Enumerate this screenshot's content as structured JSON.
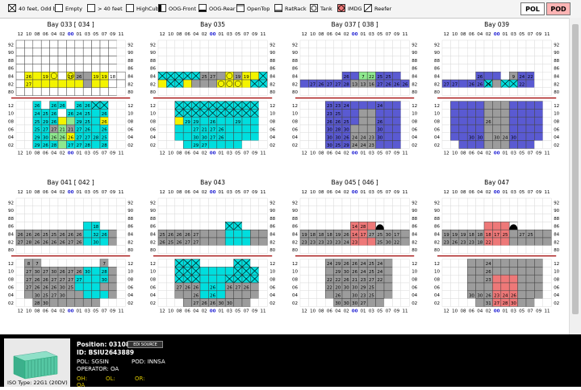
{
  "legend": [
    {
      "id": "fe40",
      "label": "40 feet, Odd bay",
      "swatch": "cross"
    },
    {
      "id": "empty",
      "label": "Empty",
      "swatch": "empty"
    },
    {
      "id": "gt40",
      "label": "> 40 feet",
      "swatch": "gt40"
    },
    {
      "id": "hc",
      "label": "HighCube",
      "swatch": "hc"
    },
    {
      "id": "oogf",
      "label": "OOG-Front",
      "swatch": "oogf"
    },
    {
      "id": "oogr",
      "label": "OOG-Rear",
      "swatch": "oogr"
    },
    {
      "id": "ot",
      "label": "OpenTop",
      "swatch": "ot"
    },
    {
      "id": "rr",
      "label": "RatRack",
      "swatch": "rr"
    },
    {
      "id": "tank",
      "label": "Tank",
      "swatch": "tank"
    },
    {
      "id": "imdg",
      "label": "IMDG",
      "swatch": "imdg"
    },
    {
      "id": "reefer",
      "label": "Reefer",
      "swatch": "reefer"
    }
  ],
  "buttons": {
    "pol": "POL",
    "pod": "POD"
  },
  "colors": {
    "cyan": "#00dede",
    "yellow": "#f4f400",
    "gray": "#9c9c9c",
    "blue": "#5a5ad2",
    "green": "#8ee88e",
    "red": "#ee7878",
    "white": "#ffffff",
    "bg": "#ffffff",
    "hatch": "#a00000"
  },
  "row_labels": [
    "12",
    "10",
    "08",
    "06",
    "04",
    "02",
    "00",
    "01",
    "03",
    "05",
    "07",
    "09",
    "11"
  ],
  "deck_tier_labels": [
    "92",
    "90",
    "88",
    "86",
    "84",
    "82",
    "80"
  ],
  "hold_tier_labels": [
    "12",
    "10",
    "08",
    "06",
    "04",
    "02"
  ],
  "bays": [
    {
      "title": "Bay 033 [ 034 ]",
      "deck": [
        "cccccccccccc.",
        "cccccccccccc.",
        "cccccccccccc.",
        "cccccccccccc.",
        "cYYYSgSGGYYcc",
        "cYYYYYYYGYYcc",
        "cccccccccccc."
      ],
      "deck_labels": [
        [],
        [],
        [],
        [],
        [
          "",
          "26",
          "",
          "19",
          "",
          "",
          "26",
          "26",
          "",
          "19",
          "19",
          "18",
          ""
        ],
        [
          "",
          "27",
          "",
          "",
          "",
          "",
          "",
          "",
          "",
          "",
          "",
          "",
          ""
        ],
        []
      ],
      "hold": [
        "..C.CC.CCXX..",
        "..CCC.CCCCC..",
        "..CCCYWCCCY..",
        "..CCGWGCCCC..",
        "..CCWWYCCCC..",
        "..CCCWCCCCC.."
      ],
      "hold_labels": [
        [
          "",
          "",
          "26",
          "",
          "26",
          "26",
          "",
          "26",
          "26",
          "",
          "",
          "",
          ""
        ],
        [
          "",
          "",
          "24",
          "25",
          "26",
          "",
          "26",
          "24",
          "25",
          "",
          "26",
          "",
          ""
        ],
        [
          "",
          "",
          "25",
          "29",
          "26",
          "",
          "",
          "29",
          "25",
          "",
          "26",
          "",
          ""
        ],
        [
          "",
          "",
          "25",
          "27",
          "27",
          "21",
          "21",
          "27",
          "26",
          "",
          "26",
          "",
          ""
        ],
        [
          "",
          "",
          "29",
          "30",
          "26",
          "26",
          "26",
          "27",
          "27",
          "28",
          "25",
          "",
          ""
        ],
        [
          "",
          "",
          "29",
          "26",
          "28",
          "",
          "27",
          "27",
          "28",
          "",
          "28",
          "",
          ""
        ]
      ]
    },
    {
      "title": "Bay 035",
      "deck": [
        ".............",
        ".............",
        ".............",
        ".............",
        "XXXXXGGGSGYYX",
        "YXXYGGGSSSYXX",
        "............."
      ],
      "deck_labels": [
        [],
        [],
        [],
        [],
        [
          "",
          "",
          "",
          "",
          "",
          "25",
          "27",
          "",
          "",
          "19",
          "19",
          "",
          ""
        ],
        [
          "",
          "",
          "",
          "",
          "",
          "",
          "",
          "",
          "",
          "",
          "",
          "",
          ""
        ],
        []
      ],
      "hold": [
        "..XXXXXXXXXX.",
        "..XXXXXXXXXX.",
        "..YCCCCCCCCC.",
        "..CCCCCCCCCC.",
        "..CCCCCCCCCC.",
        "...CCCCCCC..."
      ],
      "hold_labels": [
        [],
        [],
        [
          "",
          "",
          "",
          "29",
          "29",
          "",
          "26",
          "",
          "",
          "29",
          "",
          "",
          ""
        ],
        [
          "",
          "",
          "",
          "",
          "27",
          "21",
          "27",
          "26",
          "",
          "",
          "",
          "",
          ""
        ],
        [
          "",
          "",
          "",
          "",
          "30",
          "30",
          "27",
          "26",
          "",
          "",
          "",
          "",
          ""
        ],
        [
          "",
          "",
          "",
          "",
          "29",
          "27",
          "",
          "",
          "",
          "",
          "",
          "",
          ""
        ]
      ]
    },
    {
      "title": "Bay 037 [ 038 ]",
      "deck": [
        ".............",
        ".............",
        ".............",
        ".............",
        ".....BBWWBBB.",
        "BBBBBBGGGBBBB",
        "............."
      ],
      "deck_labels": [
        [],
        [],
        [],
        [],
        [
          "",
          "",
          "",
          "",
          "",
          "26",
          "",
          "7",
          "22",
          "25",
          "25",
          "",
          ""
        ],
        [
          "",
          "27",
          "26",
          "27",
          "27",
          "28",
          "13",
          "13",
          "16",
          "27",
          "26",
          "26",
          "26"
        ],
        []
      ],
      "hold": [
        "...BBBBBBBBB.",
        "...BBBBGGBBB.",
        "...BBBBGGBBB.",
        "...BBBGGGBBB.",
        "...BBBGGGBBB.",
        "...BBBGGGBBB."
      ],
      "hold_labels": [
        [
          "",
          "",
          "",
          "23",
          "23",
          "24",
          "",
          "",
          "",
          "24",
          "",
          "",
          ""
        ],
        [
          "",
          "",
          "",
          "23",
          "25",
          "",
          "",
          "",
          "",
          "",
          "",
          "",
          ""
        ],
        [
          "",
          "",
          "",
          "26",
          "26",
          "25",
          "",
          "",
          "",
          "26",
          "",
          "",
          ""
        ],
        [
          "",
          "",
          "",
          "30",
          "28",
          "30",
          "",
          "",
          "",
          "30",
          "",
          "",
          ""
        ],
        [
          "",
          "",
          "",
          "30",
          "30",
          "26",
          "24",
          "24",
          "23",
          "30",
          "",
          "",
          ""
        ],
        [
          "",
          "",
          "",
          "30",
          "25",
          "29",
          "24",
          "24",
          "23",
          "",
          "",
          "",
          ""
        ]
      ]
    },
    {
      "title": "Bay 039",
      "deck": [
        ".............",
        ".............",
        ".............",
        ".............",
        "....BBB.GBB..",
        "BBBBBXGXXBB..",
        "............."
      ],
      "deck_labels": [
        [],
        [],
        [],
        [],
        [
          "",
          "",
          "",
          "",
          "26",
          "",
          "",
          "",
          "9",
          "24",
          "22",
          "",
          ""
        ],
        [
          "27",
          "27",
          "",
          "26",
          "26",
          "26",
          "",
          "",
          "",
          "22",
          "",
          "",
          ""
        ],
        []
      ],
      "hold": [
        ".BBBBGGGBBBB.",
        ".BBBBGGGBBBB.",
        ".BBBBGGGBBBB.",
        ".BBBBGGGBBBB.",
        ".BBBBGGGBBBB.",
        "..BBBGGGBBB.."
      ],
      "hold_labels": [
        [],
        [],
        [
          "",
          "",
          "",
          "",
          "",
          "26",
          "",
          "",
          "",
          "",
          "",
          "",
          ""
        ],
        [
          "",
          "",
          "",
          "",
          "",
          "",
          "",
          "",
          "",
          "",
          "",
          "",
          ""
        ],
        [
          "",
          "",
          "",
          "30",
          "30",
          "",
          "30",
          "24",
          "30",
          "",
          "",
          "",
          ""
        ],
        [
          "",
          "",
          "",
          "",
          "",
          "",
          "",
          "",
          "",
          "",
          "",
          "",
          ""
        ]
      ]
    },
    {
      "title": "Bay 041 [ 042 ]",
      "deck": [
        ".............",
        ".............",
        ".............",
        "........CC...",
        "GGGGGGGGCCCG.",
        "GGGGGGGGCCCG.",
        "............."
      ],
      "deck_labels": [
        [],
        [],
        [],
        [
          "",
          "",
          "",
          "",
          "",
          "",
          "",
          "",
          "",
          "18",
          "",
          "",
          ""
        ],
        [
          "26",
          "26",
          "26",
          "25",
          "25",
          "26",
          "26",
          "26",
          "",
          "32",
          "26",
          "",
          ""
        ],
        [
          "27",
          "28",
          "26",
          "26",
          "26",
          "26",
          "27",
          "26",
          "",
          "30",
          "",
          "",
          ""
        ],
        []
      ],
      "hold": [
        ".GG.......G..",
        ".GGGGGGGCCCG.",
        ".GGGGGGCCCCG.",
        ".GGGGGGCCCGG.",
        ".GGGGGGGCCCG.",
        "..GGGGGGGG..."
      ],
      "hold_labels": [
        [
          "",
          "8",
          "7",
          "",
          "",
          "",
          "",
          "",
          "",
          "",
          "7",
          "",
          ""
        ],
        [
          "",
          "27",
          "30",
          "27",
          "30",
          "26",
          "27",
          "26",
          "30",
          "",
          "28",
          "",
          ""
        ],
        [
          "",
          "27",
          "26",
          "26",
          "27",
          "27",
          "27",
          "27",
          "",
          "",
          "30",
          "",
          ""
        ],
        [
          "",
          "27",
          "26",
          "26",
          "26",
          "30",
          "25",
          "",
          "",
          "",
          "",
          "",
          ""
        ],
        [
          "",
          "",
          "30",
          "25",
          "27",
          "30",
          "",
          "",
          "",
          "",
          "",
          "",
          ""
        ],
        [
          "",
          "",
          "28",
          "30",
          "",
          "",
          "",
          "",
          "",
          "",
          "",
          "",
          ""
        ]
      ]
    },
    {
      "title": "Bay 043",
      "deck": [
        ".............",
        ".............",
        ".............",
        "........XX...",
        "GGGGGGGGCCCGG",
        "GGGGGGGGCCCGG",
        "............."
      ],
      "deck_labels": [
        [],
        [],
        [],
        [],
        [
          "25",
          "26",
          "26",
          "26",
          "27",
          "",
          "",
          "",
          "",
          "",
          "",
          "",
          ""
        ],
        [
          "26",
          "25",
          "26",
          "27",
          "27",
          "",
          "",
          "",
          "",
          "",
          "",
          "",
          ""
        ],
        []
      ],
      "hold": [
        "..XXX....XX..",
        "..XXXCCCCXXX.",
        "..XXXCCCXXXX.",
        "..GGGCCCGGGG.",
        "..GGGCCCGGGG.",
        "...GGGGGGGG.."
      ],
      "hold_labels": [
        [],
        [],
        [],
        [
          "",
          "",
          "27",
          "26",
          "26",
          "",
          "26",
          "",
          "26",
          "27",
          "26",
          "",
          ""
        ],
        [
          "",
          "",
          "",
          "",
          "26",
          "",
          "26",
          "",
          "",
          "",
          "",
          "",
          ""
        ],
        [
          "",
          "",
          "",
          "",
          "27",
          "26",
          "26",
          "30",
          "30",
          "",
          "",
          "",
          ""
        ]
      ]
    },
    {
      "title": "Bay 045 [ 046 ]",
      "deck": [
        ".............",
        ".............",
        ".............",
        "......RRRD...",
        "GGGGGGRRGGGGG",
        "GGGGGGRRRGGGG",
        "............."
      ],
      "deck_labels": [
        [],
        [],
        [],
        [
          "",
          "",
          "",
          "",
          "",
          "",
          "14",
          "28",
          "",
          "",
          "",
          "",
          ""
        ],
        [
          "19",
          "18",
          "18",
          "18",
          "19",
          "26",
          "14",
          "17",
          "27",
          "25",
          "30",
          "17",
          ""
        ],
        [
          "23",
          "23",
          "23",
          "23",
          "23",
          "24",
          "23",
          "",
          "",
          "25",
          "30",
          "22",
          ""
        ],
        []
      ],
      "hold": [
        "...GGGGGGGG..",
        "...GGGGGGGG..",
        "...GGGGGGGG..",
        "...GGGGGGGG..",
        "...GGGGGGGG..",
        "....GGGGGG..."
      ],
      "hold_labels": [
        [
          "",
          "",
          "",
          "24",
          "29",
          "26",
          "26",
          "24",
          "25",
          "24",
          "",
          "",
          ""
        ],
        [
          "",
          "",
          "",
          "",
          "29",
          "30",
          "26",
          "24",
          "25",
          "24",
          "",
          "",
          ""
        ],
        [
          "",
          "",
          "",
          "22",
          "22",
          "26",
          "21",
          "23",
          "27",
          "22",
          "",
          "",
          ""
        ],
        [
          "",
          "",
          "",
          "22",
          "20",
          "30",
          "30",
          "29",
          "25",
          "",
          "",
          "",
          ""
        ],
        [
          "",
          "",
          "",
          "",
          "26",
          "",
          "30",
          "23",
          "25",
          "",
          "",
          "",
          ""
        ],
        [
          "",
          "",
          "",
          "",
          "30",
          "30",
          "30",
          "27",
          "",
          "",
          "",
          "",
          ""
        ]
      ]
    },
    {
      "title": "Bay 047",
      "deck": [
        ".............",
        ".............",
        ".............",
        ".....RRRD....",
        "GGGGGRRRGGGGG",
        "GGGGGRRRGGGGG",
        "............."
      ],
      "deck_labels": [
        [],
        [],
        [],
        [],
        [
          "19",
          "19",
          "19",
          "18",
          "18",
          "18",
          "17",
          "25",
          "",
          "27",
          "25",
          "",
          ""
        ],
        [
          "23",
          "26",
          "23",
          "23",
          "18",
          "22",
          "",
          "",
          "",
          "",
          "",
          "",
          ""
        ],
        []
      ],
      "hold": [
        "...GGGGGGGGG.",
        "...GGGGGGGGG.",
        "...GGGRRRGGG.",
        "...GGGRRRGGG.",
        "...GGGRRRGGG.",
        "....GGRRRGG.."
      ],
      "hold_labels": [
        [
          "",
          "",
          "",
          "",
          "",
          "24",
          "",
          "",
          "",
          "",
          "",
          "",
          ""
        ],
        [
          "",
          "",
          "",
          "",
          "",
          "26",
          "",
          "",
          "",
          "",
          "",
          "",
          ""
        ],
        [
          "",
          "",
          "",
          "",
          "",
          "23",
          "",
          "",
          "",
          "",
          "",
          "",
          ""
        ],
        [
          "",
          "",
          "",
          "",
          "",
          "",
          "",
          "",
          "",
          "",
          "",
          "",
          ""
        ],
        [
          "",
          "",
          "",
          "30",
          "30",
          "26",
          "23",
          "24",
          "26",
          "",
          "",
          "",
          ""
        ],
        [
          "",
          "",
          "",
          "",
          "",
          "31",
          "27",
          "28",
          "30",
          "",
          "",
          "",
          ""
        ]
      ]
    }
  ],
  "info": {
    "position_label": "Position: 0310808",
    "id_label": "ID: BSIU2643889",
    "edi_source": "EDI SOURCE",
    "pol": "POL: SGSIN",
    "pod": "POD: INNSA",
    "operator": "OPERATOR: OA",
    "oh": "OH:",
    "ol": "OL:",
    "or": "OR:",
    "oh2": "OA",
    "iso": "ISO Type: 22G1 (20DV)"
  }
}
